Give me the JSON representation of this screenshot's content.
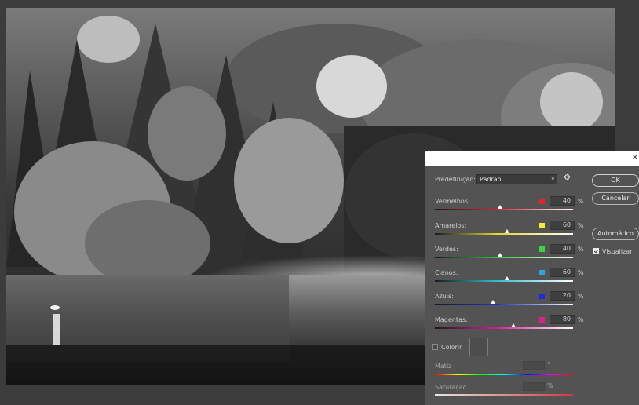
{
  "dialog": {
    "close_glyph": "×",
    "preset": {
      "label": "Predefinição:",
      "value": "Padrão"
    },
    "sliders": [
      {
        "label": "Vermelhos:",
        "value": "40",
        "unit": "%",
        "swatch": "#e8202a",
        "level": 0.47
      },
      {
        "label": "Amarelos:",
        "value": "60",
        "unit": "%",
        "swatch": "#f6ec35",
        "level": 0.52
      },
      {
        "label": "Verdes:",
        "value": "40",
        "unit": "%",
        "swatch": "#39d43f",
        "level": 0.47
      },
      {
        "label": "Cianos:",
        "value": "60",
        "unit": "%",
        "swatch": "#2aa7df",
        "level": 0.52
      },
      {
        "label": "Azuis:",
        "value": "20",
        "unit": "%",
        "swatch": "#1f2bd8",
        "level": 0.42
      },
      {
        "label": "Magentas:",
        "value": "80",
        "unit": "%",
        "swatch": "#e0208a",
        "level": 0.57
      }
    ],
    "buttons": {
      "ok": "OK",
      "cancel": "Cancelar",
      "auto": "Automático"
    },
    "preview": {
      "label": "Visualizar",
      "checked": true
    },
    "tint": {
      "label": "Colorir",
      "checked": false,
      "hue_label": "Matiz",
      "hue_unit": "°",
      "saturation_label": "Saturação",
      "saturation_unit": "%"
    }
  },
  "icons": {
    "gear": "gear-icon",
    "chevron": "chevron-down-icon"
  }
}
